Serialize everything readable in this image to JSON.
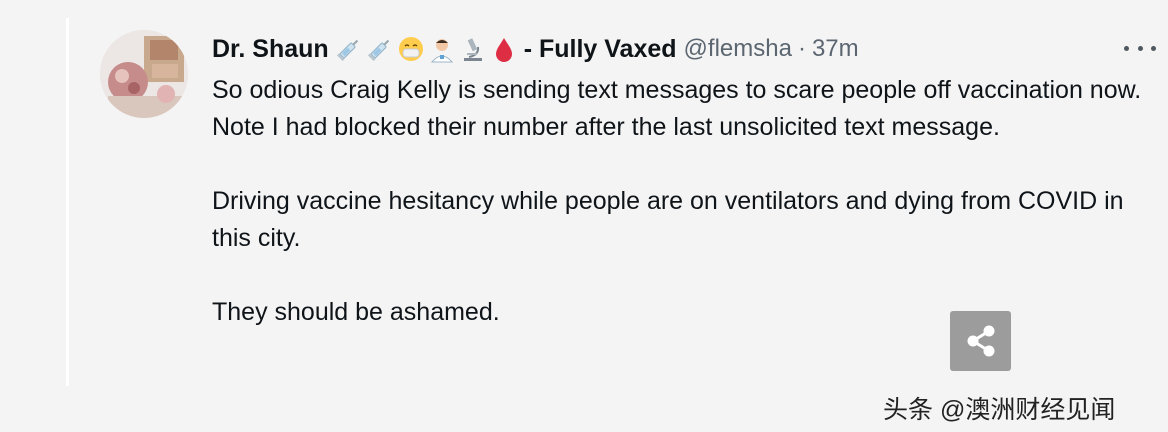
{
  "tweet": {
    "author_name": "Dr. Shaun",
    "author_name_suffix": "- Fully Vaxed",
    "emojis": [
      "syringe-icon",
      "syringe-icon",
      "mask-face-icon",
      "health-worker-icon",
      "microscope-icon",
      "blood-drop-icon"
    ],
    "handle": "@flemsha",
    "separator": "·",
    "time": "37m",
    "paragraphs": [
      "So odious Craig Kelly is sending text messages to scare people off vaccination now. Note I had blocked their number after the last unsolicited text message.",
      "Driving vaccine hesitancy while people are on ventilators and dying from COVID in this city.",
      "They should be ashamed."
    ]
  },
  "watermark": {
    "text": "头条 @澳洲财经见闻"
  },
  "colors": {
    "background": "#f4f4f4",
    "text": "#0f1419",
    "secondary_text": "#5b6670",
    "share_button": "#9c9c9c"
  }
}
